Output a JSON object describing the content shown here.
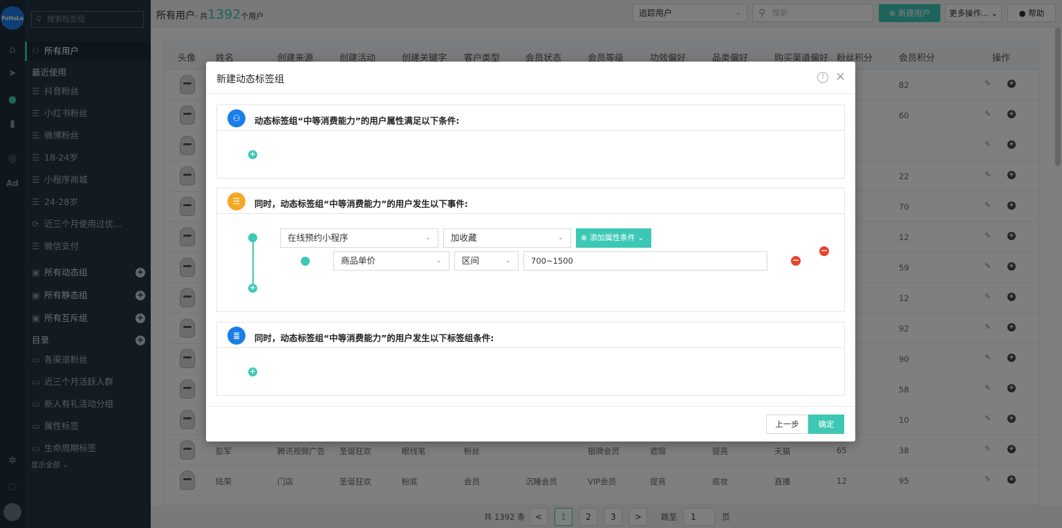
{
  "logo": "FoHoLo",
  "rail": {
    "ad_label": "Ad"
  },
  "sidebar": {
    "search_placeholder": "搜索标签组",
    "items": [
      {
        "label": "所有用户",
        "icon": "users-icon",
        "active": true
      },
      {
        "label": "最近使用",
        "icon": "",
        "head": true
      },
      {
        "label": "抖音粉丝",
        "icon": "list-icon"
      },
      {
        "label": "小红书粉丝",
        "icon": "list-icon"
      },
      {
        "label": "微博粉丝",
        "icon": "list-icon"
      },
      {
        "label": "18-24岁",
        "icon": "list-icon"
      },
      {
        "label": "小程序商城",
        "icon": "list-icon"
      },
      {
        "label": "24-28岁",
        "icon": "list-icon"
      },
      {
        "label": "近三个月使用过优...",
        "icon": "repeat-icon"
      },
      {
        "label": "微信支付",
        "icon": "list-icon"
      },
      {
        "label": "所有动态组",
        "icon": "group-icon",
        "head": true,
        "plus": true
      },
      {
        "label": "所有静态组",
        "icon": "group-icon",
        "head": true,
        "plus": true
      },
      {
        "label": "所有互斥组",
        "icon": "group-icon",
        "head": true,
        "plus": true
      },
      {
        "label": "目录",
        "icon": "",
        "head": true,
        "plus": true
      },
      {
        "label": "各渠道粉丝",
        "icon": "folder-icon"
      },
      {
        "label": "近三个月活跃人群",
        "icon": "folder-icon"
      },
      {
        "label": "新人有礼活动分组",
        "icon": "folder-icon"
      },
      {
        "label": "属性标签",
        "icon": "folder-icon"
      },
      {
        "label": "生命周期标签",
        "icon": "folder-icon"
      }
    ],
    "show_all": "显示全部 ⌄"
  },
  "topbar": {
    "title_prefix": "所有用户",
    "title_mid": "· 共",
    "count": "1392",
    "title_suffix": "个用户",
    "track_select": "追踪用户",
    "search_placeholder": "搜索",
    "new_user": "新建用户",
    "more": "更多操作... ⌄",
    "help": "帮助"
  },
  "table": {
    "headers": [
      "头像",
      "姓名",
      "创建来源",
      "创建活动",
      "创建关键字",
      "客户类型",
      "会员状态",
      "会员等级",
      "功效偏好",
      "品类偏好",
      "购买渠道偏好",
      "粉丝积分",
      "会员积分",
      "操作"
    ],
    "rows": [
      {
        "name": "",
        "source": "",
        "activity": "",
        "keyword": "",
        "ctype": "",
        "mstatus": "",
        "mlevel": "",
        "effect": "",
        "category": "",
        "channel": "",
        "fan": "",
        "member": "82"
      },
      {
        "name": "",
        "source": "",
        "activity": "",
        "keyword": "",
        "ctype": "",
        "mstatus": "",
        "mlevel": "",
        "effect": "",
        "category": "",
        "channel": "",
        "fan": "",
        "member": "60"
      },
      {
        "name": "",
        "source": "",
        "activity": "",
        "keyword": "",
        "ctype": "",
        "mstatus": "",
        "mlevel": "",
        "effect": "",
        "category": "",
        "channel": "",
        "fan": "",
        "member": ""
      },
      {
        "name": "",
        "source": "",
        "activity": "",
        "keyword": "",
        "ctype": "",
        "mstatus": "",
        "mlevel": "",
        "effect": "",
        "category": "",
        "channel": "",
        "fan": "",
        "member": "22"
      },
      {
        "name": "",
        "source": "",
        "activity": "",
        "keyword": "",
        "ctype": "",
        "mstatus": "",
        "mlevel": "",
        "effect": "",
        "category": "",
        "channel": "",
        "fan": "",
        "member": "70"
      },
      {
        "name": "",
        "source": "",
        "activity": "",
        "keyword": "",
        "ctype": "",
        "mstatus": "",
        "mlevel": "",
        "effect": "",
        "category": "",
        "channel": "",
        "fan": "",
        "member": "12"
      },
      {
        "name": "",
        "source": "",
        "activity": "",
        "keyword": "",
        "ctype": "",
        "mstatus": "",
        "mlevel": "",
        "effect": "",
        "category": "",
        "channel": "",
        "fan": "",
        "member": "59"
      },
      {
        "name": "",
        "source": "",
        "activity": "",
        "keyword": "",
        "ctype": "",
        "mstatus": "",
        "mlevel": "",
        "effect": "",
        "category": "",
        "channel": "",
        "fan": "",
        "member": "12"
      },
      {
        "name": "",
        "source": "",
        "activity": "",
        "keyword": "",
        "ctype": "",
        "mstatus": "",
        "mlevel": "",
        "effect": "",
        "category": "",
        "channel": "",
        "fan": "",
        "member": "92"
      },
      {
        "name": "",
        "source": "",
        "activity": "",
        "keyword": "",
        "ctype": "",
        "mstatus": "",
        "mlevel": "",
        "effect": "",
        "category": "",
        "channel": "",
        "fan": "",
        "member": "90"
      },
      {
        "name": "",
        "source": "",
        "activity": "",
        "keyword": "",
        "ctype": "",
        "mstatus": "",
        "mlevel": "",
        "effect": "",
        "category": "",
        "channel": "",
        "fan": "",
        "member": "58"
      },
      {
        "name": "",
        "source": "",
        "activity": "",
        "keyword": "",
        "ctype": "",
        "mstatus": "",
        "mlevel": "",
        "effect": "",
        "category": "",
        "channel": "",
        "fan": "",
        "member": "10"
      },
      {
        "name": "彭军",
        "source": "腾讯视频广告",
        "activity": "圣诞狂欢",
        "keyword": "眼线笔",
        "ctype": "粉丝",
        "mstatus": "",
        "mlevel": "银牌会员",
        "effect": "遮瑕",
        "category": "提亮",
        "channel": "天猫",
        "fan": "65",
        "member": "38"
      },
      {
        "name": "陆荣",
        "source": "门店",
        "activity": "圣诞狂欢",
        "keyword": "粉底",
        "ctype": "会员",
        "mstatus": "沉睡会员",
        "mlevel": "VIP会员",
        "effect": "提亮",
        "category": "底妆",
        "channel": "直播",
        "fan": "12",
        "member": "95"
      }
    ]
  },
  "pager": {
    "total": "共 1392 条",
    "prev": "<",
    "p1": "1",
    "p2": "2",
    "p3": "3",
    "next": ">",
    "goto": "跳至",
    "goto_value": "1",
    "page_unit": "页"
  },
  "modal": {
    "title": "新建动态标签组",
    "help": "?",
    "close": "×",
    "panel1_title": "动态标签组“中等消费能力”的用户属性满足以下条件:",
    "panel2_title": "同时，动态标签组“中等消费能力”的用户发生以下事件:",
    "panel3_title": "同时，动态标签组“中等消费能力”的用户发生以下标签组条件:",
    "event_select": "在线预约小程序",
    "action_select": "加收藏",
    "add_attr": "添加属性条件",
    "attr_select": "商品单价",
    "op_select": "区间",
    "range_value": "700~1500",
    "prev": "上一步",
    "ok": "确定"
  },
  "colors": {
    "accent": "#3cc8b4",
    "danger": "#e8432e",
    "blue": "#1a7ee8",
    "orange": "#f5a623"
  }
}
